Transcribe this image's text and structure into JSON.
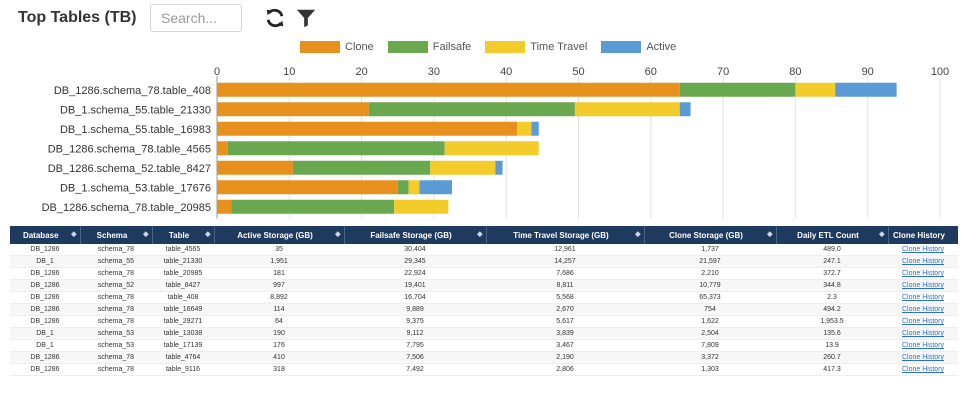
{
  "header": {
    "title": "Top Tables (TB)",
    "search_placeholder": "Search...",
    "refresh_icon": "refresh-icon",
    "filter_icon": "filter-icon"
  },
  "colors": {
    "clone": "#e8901e",
    "failsafe": "#6aa84f",
    "time_travel": "#f3cc2c",
    "active": "#5b9bd5",
    "table_header": "#1f3a5f",
    "link": "#2a6fd6"
  },
  "chart_data": {
    "type": "bar",
    "orientation": "horizontal",
    "stacked": true,
    "categories": [
      "DB_1286.schema_78.table_408",
      "DB_1.schema_55.table_21330",
      "DB_1.schema_55.table_16983",
      "DB_1286.schema_78.table_4565",
      "DB_1286.schema_52.table_8427",
      "DB_1.schema_53.table_17676",
      "DB_1286.schema_78.table_20985"
    ],
    "series": [
      {
        "name": "Clone",
        "color": "#e8901e",
        "values": [
          64,
          21,
          41.5,
          1.5,
          10.5,
          25,
          2
        ]
      },
      {
        "name": "Failsafe",
        "color": "#6aa84f",
        "values": [
          16,
          28.5,
          0,
          30,
          19,
          1.5,
          22.5
        ]
      },
      {
        "name": "Time Travel",
        "color": "#f3cc2c",
        "values": [
          5.5,
          14.5,
          2,
          13,
          9,
          1.5,
          7.5
        ]
      },
      {
        "name": "Active",
        "color": "#5b9bd5",
        "values": [
          8.5,
          1.5,
          1,
          0,
          1,
          4.5,
          0
        ]
      }
    ],
    "xlim": [
      0,
      100
    ],
    "xticks": [
      0,
      10,
      20,
      30,
      40,
      50,
      60,
      70,
      80,
      90,
      100
    ],
    "legend_position": "top",
    "grid": true,
    "title": "",
    "xlabel": "",
    "ylabel": ""
  },
  "table": {
    "columns": [
      "Database",
      "Schema",
      "Table",
      "Active Storage (GB)",
      "Failsafe Storage (GB)",
      "Time Travel Storage (GB)",
      "Clone Storage (GB)",
      "Daily ETL Count",
      "Clone History"
    ],
    "rows": [
      [
        "DB_1286",
        "schema_78",
        "table_4565",
        "35",
        "30,404",
        "12,961",
        "1,737",
        "489.0",
        "Clone History"
      ],
      [
        "DB_1",
        "schema_55",
        "table_21330",
        "1,951",
        "29,345",
        "14,257",
        "21,597",
        "247.1",
        "Clone History"
      ],
      [
        "DB_1286",
        "schema_78",
        "table_20985",
        "181",
        "22,924",
        "7,686",
        "2,210",
        "372.7",
        "Clone History"
      ],
      [
        "DB_1286",
        "schema_52",
        "table_8427",
        "997",
        "19,401",
        "8,811",
        "10,779",
        "344.8",
        "Clone History"
      ],
      [
        "DB_1286",
        "schema_78",
        "table_408",
        "8,892",
        "16,704",
        "5,568",
        "65,373",
        "2.3",
        "Clone History"
      ],
      [
        "DB_1286",
        "schema_78",
        "table_16649",
        "114",
        "9,889",
        "2,670",
        "754",
        "494.2",
        "Clone History"
      ],
      [
        "DB_1286",
        "schema_78",
        "table_29271",
        "64",
        "9,375",
        "5,617",
        "1,622",
        "1,953.5",
        "Clone History"
      ],
      [
        "DB_1",
        "schema_53",
        "table_13038",
        "190",
        "9,112",
        "3,839",
        "2,504",
        "135.6",
        "Clone History"
      ],
      [
        "DB_1",
        "schema_53",
        "table_17139",
        "176",
        "7,795",
        "3,467",
        "7,809",
        "13.9",
        "Clone History"
      ],
      [
        "DB_1286",
        "schema_78",
        "table_4764",
        "410",
        "7,506",
        "2,190",
        "3,372",
        "260.7",
        "Clone History"
      ],
      [
        "DB_1286",
        "schema_78",
        "table_9116",
        "318",
        "7,492",
        "2,806",
        "1,303",
        "417.3",
        "Clone History"
      ]
    ]
  }
}
